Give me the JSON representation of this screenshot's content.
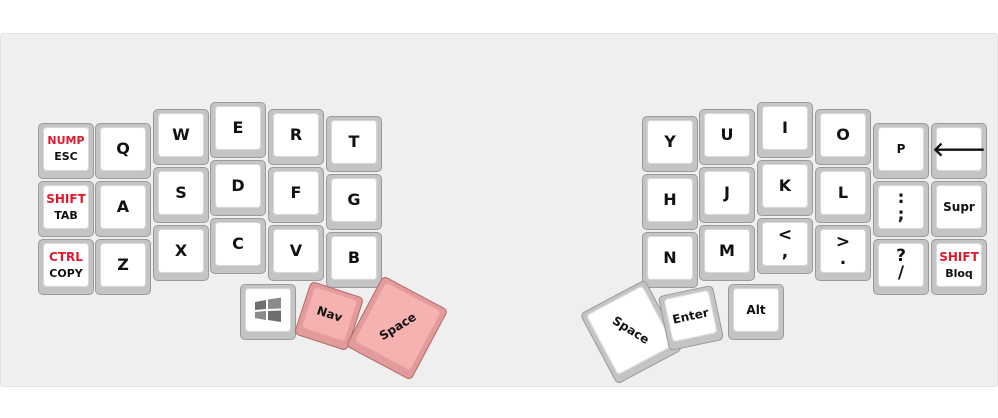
{
  "left": {
    "nump_esc": {
      "top": "NUMP",
      "bottom": "ESC"
    },
    "shift_tab": {
      "top": "SHIFT",
      "bottom": "TAB"
    },
    "ctrl_copy": {
      "top": "CTRL",
      "bottom": "COPY"
    },
    "q": "Q",
    "a": "A",
    "z": "Z",
    "w": "W",
    "s": "S",
    "x": "X",
    "e": "E",
    "d": "D",
    "c": "C",
    "r": "R",
    "f": "F",
    "v": "V",
    "t": "T",
    "g": "G",
    "b": "B",
    "win_icon": "windows-icon",
    "nav": "Nav",
    "space": "Space"
  },
  "right": {
    "y": "Y",
    "h": "H",
    "n": "N",
    "u": "U",
    "j": "J",
    "m": "M",
    "i": "I",
    "k": "K",
    "comma": {
      "top": "<",
      "bottom": ","
    },
    "o": "O",
    "l": "L",
    "period": {
      "top": ">",
      "bottom": "."
    },
    "p": "P",
    "semicolon": {
      "top": ":",
      "bottom": ";"
    },
    "slash": {
      "top": "?",
      "bottom": "/"
    },
    "backspace_icon": "left-arrow-icon",
    "supr": "Supr",
    "shift_bloq": {
      "top": "SHIFT",
      "bottom": "Bloq"
    },
    "space": "Space",
    "enter": "Enter",
    "alt": "Alt"
  },
  "colors": {
    "modifier_red": "#e0182d",
    "thumb_pink": "#f6b1b1",
    "key_frame": "#c4c4c4"
  }
}
